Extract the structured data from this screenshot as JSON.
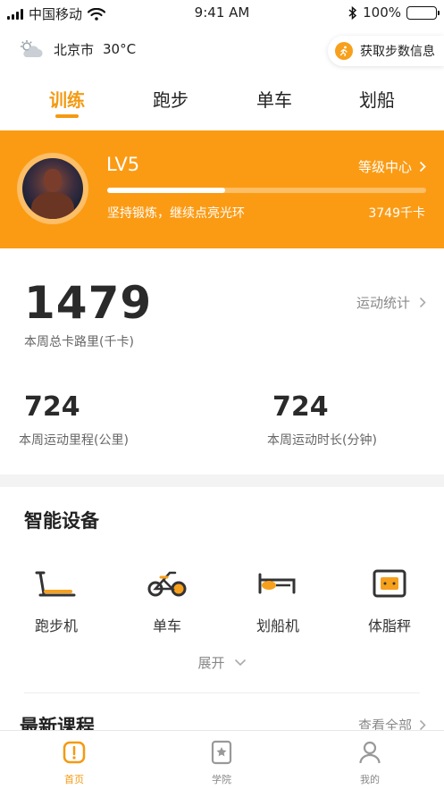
{
  "status_bar": {
    "carrier": "中国移动",
    "time": "9:41 AM",
    "battery": "100%"
  },
  "weather": {
    "icon": "cloud-sun-icon",
    "city": "北京市",
    "temperature": "30°C"
  },
  "steps_button": {
    "label": "获取步数信息",
    "icon": "runner-icon"
  },
  "tabs": [
    {
      "label": "训练",
      "active": true
    },
    {
      "label": "跑步",
      "active": false
    },
    {
      "label": "单车",
      "active": false
    },
    {
      "label": "划船",
      "active": false
    }
  ],
  "level": {
    "name": "LV5",
    "center_label": "等级中心",
    "progress_fraction": 0.37,
    "motto": "坚持锻炼，继续点亮光环",
    "calories": "3749千卡"
  },
  "stats": {
    "weekly_calories": "1479",
    "weekly_calories_label": "本周总卡路里(千卡)",
    "sport_stats_link": "运动统计",
    "distance": "724",
    "distance_label": "本周运动里程(公里)",
    "duration": "724",
    "duration_label": "本周运动时长(分钟)"
  },
  "devices": {
    "title": "智能设备",
    "items": [
      {
        "label": "跑步机",
        "icon": "treadmill-icon"
      },
      {
        "label": "单车",
        "icon": "bike-icon"
      },
      {
        "label": "划船机",
        "icon": "rowing-machine-icon"
      },
      {
        "label": "体脂秤",
        "icon": "body-fat-scale-icon"
      }
    ],
    "expand_label": "展开"
  },
  "courses": {
    "title": "最新课程",
    "view_all": "查看全部"
  },
  "bottom_nav": [
    {
      "label": "首页",
      "icon": "home-icon",
      "active": true
    },
    {
      "label": "学院",
      "icon": "academy-icon",
      "active": false
    },
    {
      "label": "我的",
      "icon": "profile-icon",
      "active": false
    }
  ],
  "colors": {
    "accent": "#fb9b14",
    "dark": "#2a2a2a",
    "muted": "#888888"
  }
}
